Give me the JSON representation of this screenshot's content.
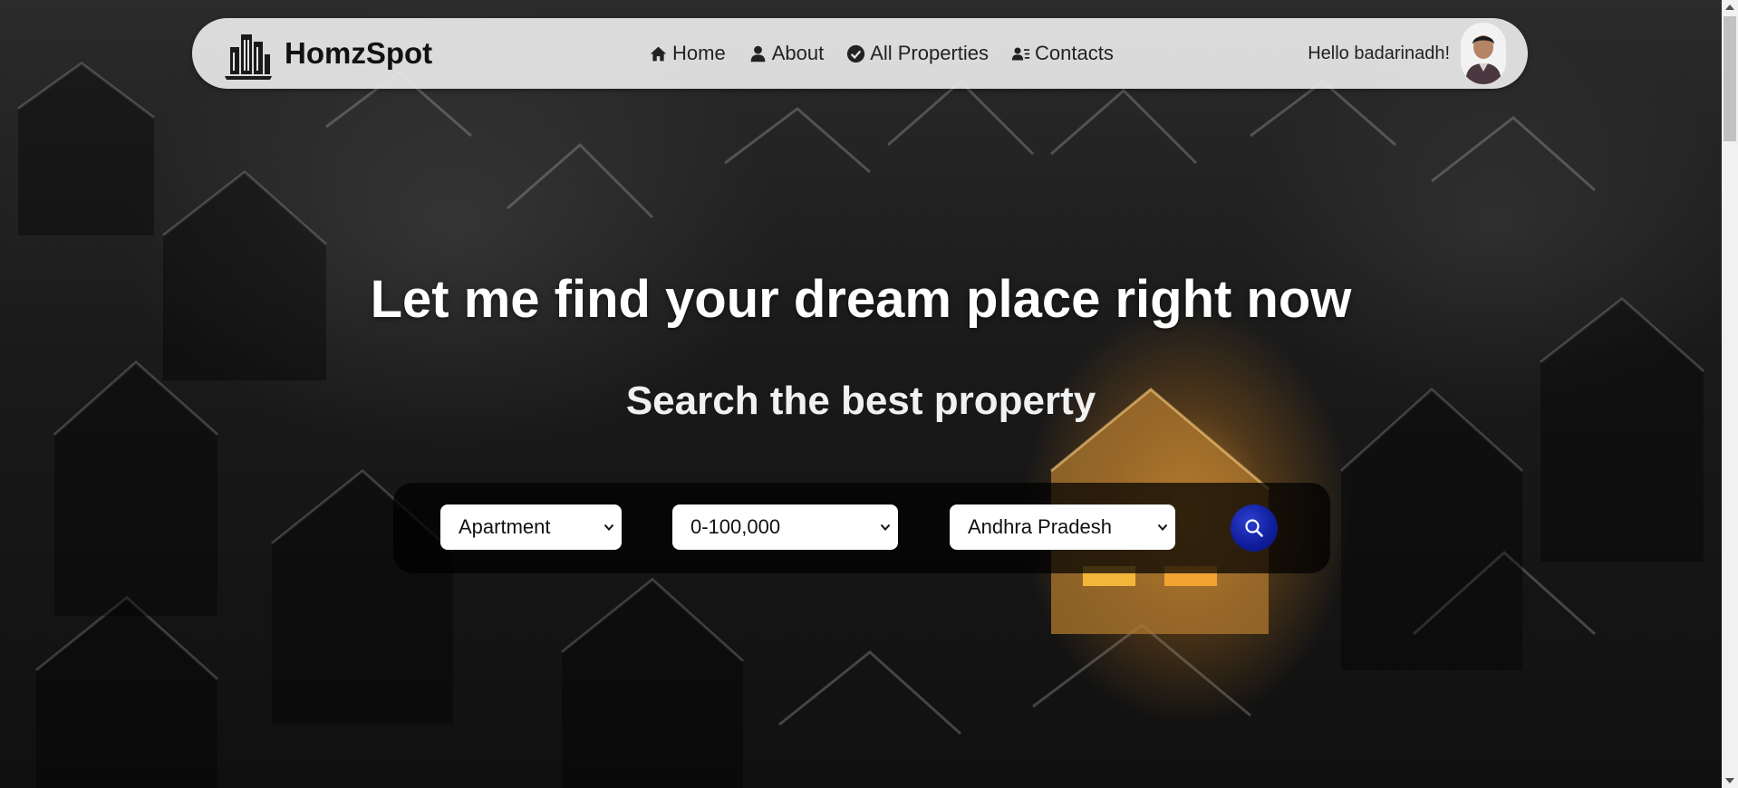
{
  "brand": {
    "name": "HomzSpot",
    "logo_icon": "city-buildings-icon"
  },
  "nav": {
    "items": [
      {
        "label": "Home",
        "icon": "home-icon"
      },
      {
        "label": "About",
        "icon": "user-icon"
      },
      {
        "label": "All Properties",
        "icon": "check-circle-icon"
      },
      {
        "label": "Contacts",
        "icon": "address-card-icon"
      }
    ]
  },
  "user": {
    "greeting": "Hello badarinadh!",
    "avatar_icon": "user-avatar"
  },
  "hero": {
    "title": "Let me find your dream place right now",
    "subtitle": "Search the best property"
  },
  "search": {
    "property_type": "Apartment",
    "price_range": "0-100,000",
    "state": "Andhra Pradesh",
    "button_icon": "search-icon",
    "button_color": "#1325a8"
  },
  "colors": {
    "navbar_bg": "#e8e8e8",
    "text_dark": "#111111",
    "hero_text": "#ffffff"
  }
}
